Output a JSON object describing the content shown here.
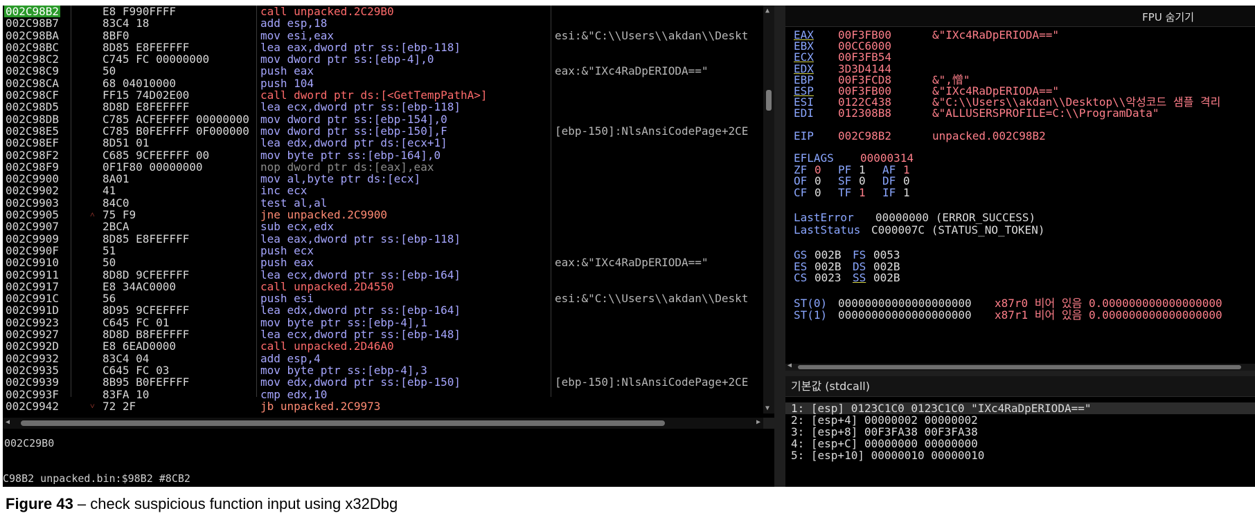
{
  "disasm": {
    "rows": [
      {
        "addr": "002C98B2",
        "arrow": "",
        "bytes": "E8 F990FFFF",
        "instr": "call unpacked.2C29B0",
        "kind": "call",
        "comment": "",
        "selected": true
      },
      {
        "addr": "002C98B7",
        "arrow": "",
        "bytes": "83C4 18",
        "instr": "add esp,18",
        "kind": "other",
        "comment": ""
      },
      {
        "addr": "002C98BA",
        "arrow": "",
        "bytes": "8BF0",
        "instr": "mov esi,eax",
        "kind": "other",
        "comment": "esi:&\"C:\\\\Users\\\\akdan\\\\Deskt"
      },
      {
        "addr": "002C98BC",
        "arrow": "",
        "bytes": "8D85 E8FEFFFF",
        "instr": "lea eax,dword ptr ss:[ebp-118]",
        "kind": "other",
        "comment": ""
      },
      {
        "addr": "002C98C2",
        "arrow": "",
        "bytes": "C745 FC 00000000",
        "instr": "mov dword ptr ss:[ebp-4],0",
        "kind": "other",
        "comment": ""
      },
      {
        "addr": "002C98C9",
        "arrow": "",
        "bytes": "50",
        "instr": "push eax",
        "kind": "other",
        "comment": "eax:&\"IXc4RaDpERIODA==\""
      },
      {
        "addr": "002C98CA",
        "arrow": "",
        "bytes": "68 04010000",
        "instr": "push 104",
        "kind": "other",
        "comment": ""
      },
      {
        "addr": "002C98CF",
        "arrow": "",
        "bytes": "FF15 74D02E00",
        "instr": "call dword ptr ds:[<GetTempPathA>]",
        "kind": "call",
        "comment": ""
      },
      {
        "addr": "002C98D5",
        "arrow": "",
        "bytes": "8D8D E8FEFFFF",
        "instr": "lea ecx,dword ptr ss:[ebp-118]",
        "kind": "other",
        "comment": ""
      },
      {
        "addr": "002C98DB",
        "arrow": "",
        "bytes": "C785 ACFEFFFF 00000000",
        "instr": "mov dword ptr ss:[ebp-154],0",
        "kind": "other",
        "comment": ""
      },
      {
        "addr": "002C98E5",
        "arrow": "",
        "bytes": "C785 B0FEFFFF 0F000000",
        "instr": "mov dword ptr ss:[ebp-150],F",
        "kind": "other",
        "comment": "[ebp-150]:NlsAnsiCodePage+2CE"
      },
      {
        "addr": "002C98EF",
        "arrow": "",
        "bytes": "8D51 01",
        "instr": "lea edx,dword ptr ds:[ecx+1]",
        "kind": "other",
        "comment": ""
      },
      {
        "addr": "002C98F2",
        "arrow": "",
        "bytes": "C685 9CFEFFFF 00",
        "instr": "mov byte ptr ss:[ebp-164],0",
        "kind": "other",
        "comment": ""
      },
      {
        "addr": "002C98F9",
        "arrow": "",
        "bytes": "0F1F80 00000000",
        "instr": "nop dword ptr ds:[eax],eax",
        "kind": "nop",
        "comment": ""
      },
      {
        "addr": "002C9900",
        "arrow": "",
        "bytes": "8A01",
        "instr": "mov al,byte ptr ds:[ecx]",
        "kind": "other",
        "comment": ""
      },
      {
        "addr": "002C9902",
        "arrow": "",
        "bytes": "41",
        "instr": "inc ecx",
        "kind": "other",
        "comment": ""
      },
      {
        "addr": "002C9903",
        "arrow": "",
        "bytes": "84C0",
        "instr": "test al,al",
        "kind": "other",
        "comment": ""
      },
      {
        "addr": "002C9905",
        "arrow": "˄",
        "bytes": "75 F9",
        "instr": "jne unpacked.2C9900",
        "kind": "jmp",
        "comment": ""
      },
      {
        "addr": "002C9907",
        "arrow": "",
        "bytes": "2BCA",
        "instr": "sub ecx,edx",
        "kind": "other",
        "comment": ""
      },
      {
        "addr": "002C9909",
        "arrow": "",
        "bytes": "8D85 E8FEFFFF",
        "instr": "lea eax,dword ptr ss:[ebp-118]",
        "kind": "other",
        "comment": ""
      },
      {
        "addr": "002C990F",
        "arrow": "",
        "bytes": "51",
        "instr": "push ecx",
        "kind": "other",
        "comment": ""
      },
      {
        "addr": "002C9910",
        "arrow": "",
        "bytes": "50",
        "instr": "push eax",
        "kind": "other",
        "comment": "eax:&\"IXc4RaDpERIODA==\""
      },
      {
        "addr": "002C9911",
        "arrow": "",
        "bytes": "8D8D 9CFEFFFF",
        "instr": "lea ecx,dword ptr ss:[ebp-164]",
        "kind": "other",
        "comment": ""
      },
      {
        "addr": "002C9917",
        "arrow": "",
        "bytes": "E8 34AC0000",
        "instr": "call unpacked.2D4550",
        "kind": "call",
        "comment": ""
      },
      {
        "addr": "002C991C",
        "arrow": "",
        "bytes": "56",
        "instr": "push esi",
        "kind": "other",
        "comment": "esi:&\"C:\\\\Users\\\\akdan\\\\Deskt"
      },
      {
        "addr": "002C991D",
        "arrow": "",
        "bytes": "8D95 9CFEFFFF",
        "instr": "lea edx,dword ptr ss:[ebp-164]",
        "kind": "other",
        "comment": ""
      },
      {
        "addr": "002C9923",
        "arrow": "",
        "bytes": "C645 FC 01",
        "instr": "mov byte ptr ss:[ebp-4],1",
        "kind": "other",
        "comment": ""
      },
      {
        "addr": "002C9927",
        "arrow": "",
        "bytes": "8D8D B8FEFFFF",
        "instr": "lea ecx,dword ptr ss:[ebp-148]",
        "kind": "other",
        "comment": ""
      },
      {
        "addr": "002C992D",
        "arrow": "",
        "bytes": "E8 6EAD0000",
        "instr": "call unpacked.2D46A0",
        "kind": "call",
        "comment": ""
      },
      {
        "addr": "002C9932",
        "arrow": "",
        "bytes": "83C4 04",
        "instr": "add esp,4",
        "kind": "other",
        "comment": ""
      },
      {
        "addr": "002C9935",
        "arrow": "",
        "bytes": "C645 FC 03",
        "instr": "mov byte ptr ss:[ebp-4],3",
        "kind": "other",
        "comment": ""
      },
      {
        "addr": "002C9939",
        "arrow": "",
        "bytes": "8B95 B0FEFFFF",
        "instr": "mov edx,dword ptr ss:[ebp-150]",
        "kind": "other",
        "comment": "[ebp-150]:NlsAnsiCodePage+2CE"
      },
      {
        "addr": "002C993F",
        "arrow": "",
        "bytes": "83FA 10",
        "instr": "cmp edx,10",
        "kind": "other",
        "comment": ""
      },
      {
        "addr": "002C9942",
        "arrow": "˅",
        "bytes": "72 2F",
        "instr": "jb unpacked.2C9973",
        "kind": "jmp",
        "comment": ""
      }
    ]
  },
  "info": {
    "line1": "002C29B0",
    "line2": "C98B2 unpacked.bin:$98B2 #8CB2"
  },
  "registers": {
    "fpu_label": "FPU 숨기기",
    "gp": [
      {
        "name": "EAX",
        "value": "00F3FB00",
        "comment": "&\"IXc4RaDpERIODA==\"",
        "ul": true
      },
      {
        "name": "EBX",
        "value": "00CC6000",
        "comment": "",
        "ul": false
      },
      {
        "name": "ECX",
        "value": "00F3FB54",
        "comment": "",
        "ul": true
      },
      {
        "name": "EDX",
        "value": "3D3D4144",
        "comment": "",
        "ul": true
      },
      {
        "name": "EBP",
        "value": "00F3FCD8",
        "comment": "&\",憎\"",
        "ul": false
      },
      {
        "name": "ESP",
        "value": "00F3FB00",
        "comment": "&\"IXc4RaDpERIODA==\"",
        "ul": true
      },
      {
        "name": "ESI",
        "value": "0122C438",
        "comment": "&\"C:\\\\Users\\\\akdan\\\\Desktop\\\\악성코드 샘플 격리",
        "ul": false
      },
      {
        "name": "EDI",
        "value": "012308B8",
        "comment": "&\"ALLUSERSPROFILE=C:\\\\ProgramData\"",
        "ul": false
      }
    ],
    "eip": {
      "name": "EIP",
      "value": "002C98B2",
      "comment": "unpacked.002C98B2"
    },
    "eflags": {
      "name": "EFLAGS",
      "value": "00000314"
    },
    "flags": [
      [
        {
          "n": "ZF",
          "v": "0",
          "red": true
        },
        {
          "n": "PF",
          "v": "1",
          "red": false
        },
        {
          "n": "AF",
          "v": "1",
          "red": true
        }
      ],
      [
        {
          "n": "OF",
          "v": "0",
          "red": false
        },
        {
          "n": "SF",
          "v": "0",
          "red": false
        },
        {
          "n": "DF",
          "v": "0",
          "red": false
        }
      ],
      [
        {
          "n": "CF",
          "v": "0",
          "red": false
        },
        {
          "n": "TF",
          "v": "1",
          "red": true
        },
        {
          "n": "IF",
          "v": "1",
          "red": false
        }
      ]
    ],
    "last_error": {
      "name": "LastError",
      "value": "00000000 (ERROR_SUCCESS)"
    },
    "last_status": {
      "name": "LastStatus",
      "value": "C000007C (STATUS_NO_TOKEN)"
    },
    "segs": [
      [
        {
          "n": "GS",
          "v": "002B"
        },
        {
          "n": "FS",
          "v": "0053"
        }
      ],
      [
        {
          "n": "ES",
          "v": "002B"
        },
        {
          "n": "DS",
          "v": "002B"
        }
      ],
      [
        {
          "n": "CS",
          "v": "0023"
        },
        {
          "n": "SS",
          "v": "002B"
        }
      ]
    ],
    "st": [
      {
        "n": "ST(0)",
        "v": "00000000000000000000",
        "x": "x87r0 비어 있음 0.000000000000000000"
      },
      {
        "n": "ST(1)",
        "v": "00000000000000000000",
        "x": "x87r1 비어 있음 0.000000000000000000"
      }
    ]
  },
  "stack": {
    "header": "기본값 (stdcall)",
    "rows": [
      "1: [esp] 0123C1C0 0123C1C0 \"IXc4RaDpERIODA==\"",
      "2: [esp+4] 00000002 00000002",
      "3: [esp+8] 00F3FA38 00F3FA38",
      "4: [esp+C] 00000000 00000000",
      "5: [esp+10] 00000010 00000010"
    ]
  },
  "caption": {
    "label": "Figure 43",
    "text": " –  check suspicious function input using x32Dbg"
  }
}
